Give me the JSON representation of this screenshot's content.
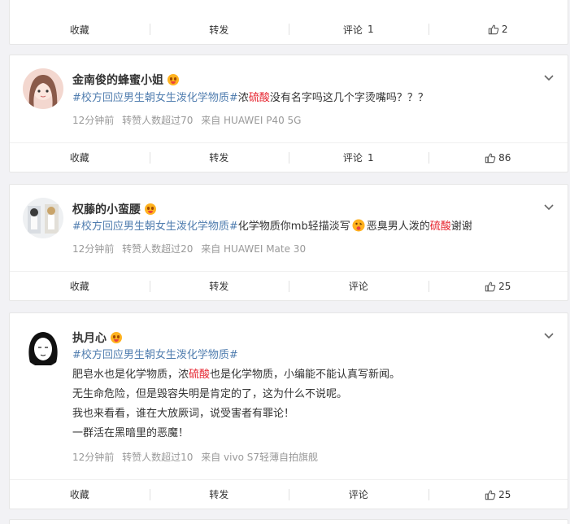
{
  "card0": {
    "actions": {
      "favorite": "收藏",
      "repost": "转发",
      "comment": "评论",
      "comment_count": "1",
      "like_count": "2"
    }
  },
  "card1": {
    "username": "金南俊的蜂蜜小姐",
    "topic": "#校方回应男生朝女生泼化学物质#",
    "text_a": "浓",
    "highlight": "硫酸",
    "text_b": "没有名字吗这几个字烫嘴吗？？？",
    "time": "12分钟前",
    "reposts": "转赞人数超过70",
    "source": "来自 HUAWEI P40 5G",
    "actions": {
      "favorite": "收藏",
      "repost": "转发",
      "comment": "评论",
      "comment_count": "1",
      "like_count": "86"
    }
  },
  "card2": {
    "username": "权藤的小蛮腰",
    "topic": "#校方回应男生朝女生泼化学物质#",
    "text_a": "化学物质你mb轻描淡写",
    "text_b": "恶臭男人泼的",
    "highlight": "硫酸",
    "text_c": "谢谢",
    "time": "12分钟前",
    "reposts": "转赞人数超过20",
    "source": "来自 HUAWEI Mate 30",
    "actions": {
      "favorite": "收藏",
      "repost": "转发",
      "comment": "评论",
      "like_count": "25"
    }
  },
  "card3": {
    "username": "执月心",
    "topic": "#校方回应男生朝女生泼化学物质#",
    "line1_a": "肥皂水也是化学物质，浓",
    "highlight": "硫酸",
    "line1_b": "也是化学物质，小编能不能认真写新闻。",
    "line2": "无生命危险，但是毁容失明是肯定的了，这为什么不说呢。",
    "line3": "我也来看看，谁在大放厥词，说受害者有罪论！",
    "line4": "一群活在黑暗里的恶魔！",
    "time": "12分钟前",
    "reposts": "转赞人数超过10",
    "source": "来自 vivo S7轻薄自拍旗舰",
    "actions": {
      "favorite": "收藏",
      "repost": "转发",
      "comment": "评论",
      "like_count": "25"
    }
  },
  "colors": {
    "topic": "#507daf",
    "highlight": "#e6222d",
    "meta": "#999999"
  }
}
